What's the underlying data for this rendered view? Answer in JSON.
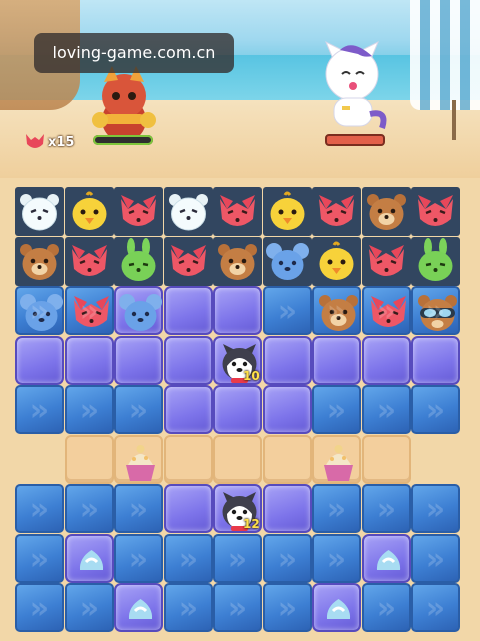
{
  "watermark": "loving-game.com.cn",
  "moves_counter": "x15",
  "pieces": {
    "husky_top_count": "10",
    "husky_bottom_count": "12"
  },
  "colors": {
    "ice": "#3d7fd3",
    "purple": "#7d74ea",
    "sand": "#f3cf9d",
    "board_bg": "#324660"
  }
}
